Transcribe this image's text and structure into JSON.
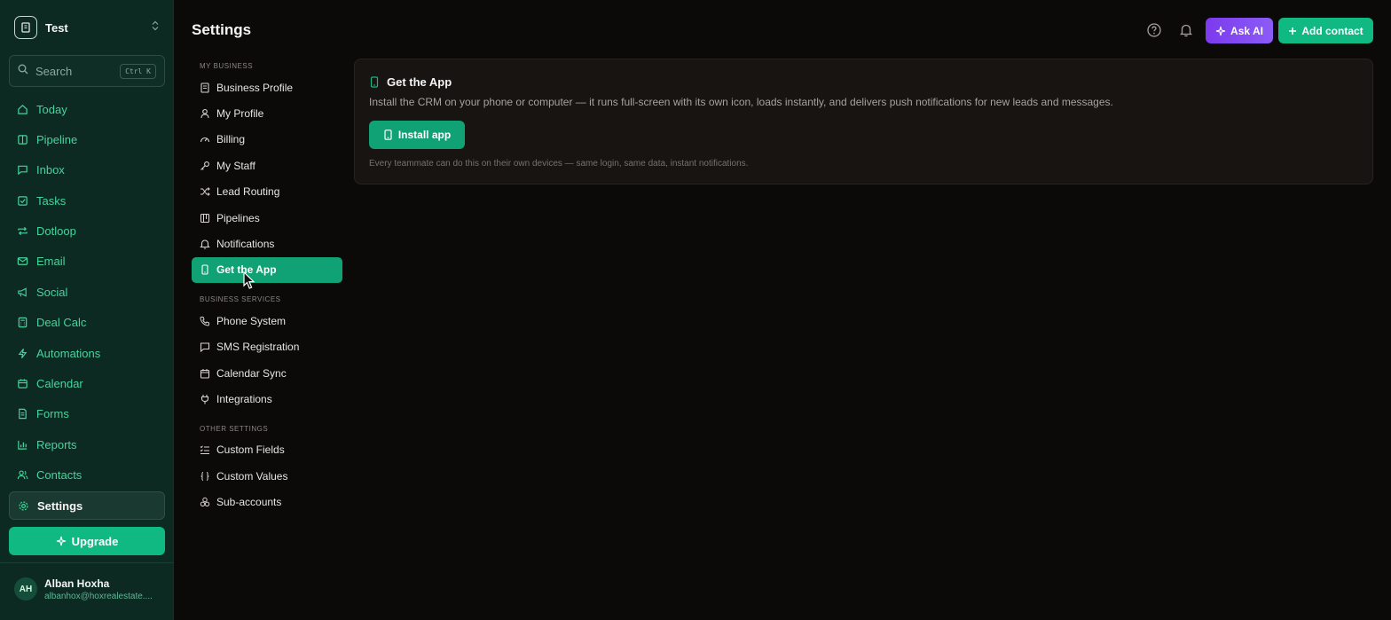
{
  "app": {
    "workspace_name": "Test",
    "search_label": "Search",
    "search_shortcut": "Ctrl K"
  },
  "nav": [
    {
      "label": "Today",
      "icon": "home-icon"
    },
    {
      "label": "Pipeline",
      "icon": "columns-icon"
    },
    {
      "label": "Inbox",
      "icon": "chat-icon"
    },
    {
      "label": "Tasks",
      "icon": "checkbox-icon"
    },
    {
      "label": "Dotloop",
      "icon": "repeat-icon"
    },
    {
      "label": "Email",
      "icon": "mail-icon"
    },
    {
      "label": "Social",
      "icon": "megaphone-icon"
    },
    {
      "label": "Deal Calc",
      "icon": "calculator-icon"
    },
    {
      "label": "Automations",
      "icon": "bolt-icon"
    },
    {
      "label": "Calendar",
      "icon": "calendar-icon"
    },
    {
      "label": "Forms",
      "icon": "file-icon"
    },
    {
      "label": "Reports",
      "icon": "bar-chart-icon"
    },
    {
      "label": "Contacts",
      "icon": "users-icon"
    },
    {
      "label": "Settings",
      "icon": "gear-icon",
      "active": true
    }
  ],
  "upgrade_label": "Upgrade",
  "user": {
    "initials": "AH",
    "name": "Alban Hoxha",
    "email": "albanhox@hoxrealestate...."
  },
  "header": {
    "title": "Settings",
    "ask_ai_label": "Ask AI",
    "add_contact_label": "Add contact"
  },
  "settings_nav": {
    "my_business_label": "MY BUSINESS",
    "my_business": [
      {
        "label": "Business Profile",
        "icon": "building-icon"
      },
      {
        "label": "My Profile",
        "icon": "user-icon"
      },
      {
        "label": "Billing",
        "icon": "gauge-icon"
      },
      {
        "label": "My Staff",
        "icon": "key-icon"
      },
      {
        "label": "Lead Routing",
        "icon": "shuffle-icon"
      },
      {
        "label": "Pipelines",
        "icon": "columns-icon"
      },
      {
        "label": "Notifications",
        "icon": "bell-icon"
      },
      {
        "label": "Get the App",
        "icon": "phone-icon",
        "active": true
      }
    ],
    "business_services_label": "BUSINESS SERVICES",
    "business_services": [
      {
        "label": "Phone System",
        "icon": "phone-call-icon"
      },
      {
        "label": "SMS Registration",
        "icon": "chat-icon"
      },
      {
        "label": "Calendar Sync",
        "icon": "calendar-icon"
      },
      {
        "label": "Integrations",
        "icon": "plug-icon"
      }
    ],
    "other_settings_label": "OTHER SETTINGS",
    "other_settings": [
      {
        "label": "Custom Fields",
        "icon": "list-checks-icon"
      },
      {
        "label": "Custom Values",
        "icon": "braces-icon"
      },
      {
        "label": "Sub-accounts",
        "icon": "network-icon"
      }
    ]
  },
  "card": {
    "title": "Get the App",
    "description": "Install the CRM on your phone or computer — it runs full-screen with its own icon, loads instantly, and delivers push notifications for new leads and messages.",
    "install_label": "Install app",
    "note": "Every teammate can do this on their own devices — same login, same data, instant notifications."
  },
  "colors": {
    "accent": "#10b981",
    "sidebar_bg": "#0c2a22",
    "ai_purple": "#7c3aed",
    "page_bg": "#0c0a09"
  }
}
